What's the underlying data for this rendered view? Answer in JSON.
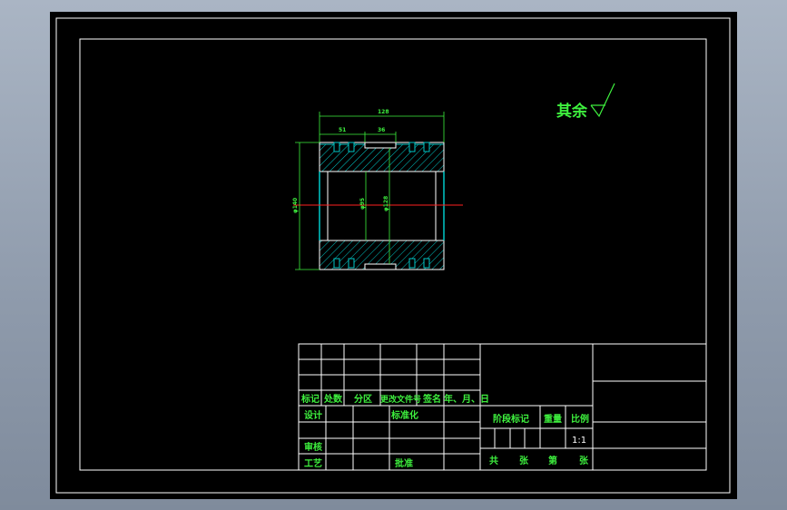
{
  "colors": {
    "background": "#000000",
    "linework": "#ffffff",
    "text": "#3ef03e",
    "hatch_outline": "#00c8c8",
    "dimension": "#3ef03e",
    "centerline": "#ff2020"
  },
  "surface_finish": {
    "label": "其余"
  },
  "dimensions": {
    "overall_length": "128",
    "left_step": "51",
    "groove": "36",
    "outer_diameter": "φ140",
    "bore_diameter": "φ95",
    "inner_diameter": "φ128"
  },
  "title_block": {
    "revision_headers": [
      "标记",
      "处数",
      "分区",
      "更改文件号",
      "签名",
      "年、月、日"
    ],
    "design": "设计",
    "standardization": "标准化",
    "review": "审核",
    "process": "工艺",
    "approve": "批准",
    "stage_mark": "阶段标记",
    "weight": "重量",
    "scale_label": "比例",
    "scale_value": "1:1",
    "total": "共",
    "sheets": "张",
    "number": "第",
    "sheet": "张"
  }
}
